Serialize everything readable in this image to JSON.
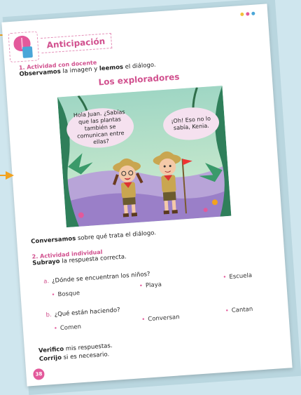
{
  "section": {
    "title": "Anticipación"
  },
  "activity1": {
    "label": "1. Actividad con docente",
    "instruction_b1": "Observamos",
    "instruction_t1": " la imagen y ",
    "instruction_b2": "leemos",
    "instruction_t2": " el diálogo."
  },
  "story": {
    "title": "Los exploradores",
    "bubble_left": "Hola Juan. ¿Sabías que las plantas también se comunican entre ellas?",
    "bubble_right": "¡Oh! Eso no lo sabía, Kenia."
  },
  "discussion": {
    "bold": "Conversamos",
    "text": " sobre qué trata el diálogo."
  },
  "activity2": {
    "label": "2. Actividad individual",
    "instruction_b": "Subrayo",
    "instruction_t": " la respuesta correcta.",
    "questions": [
      {
        "letter": "a.",
        "text": "¿Dónde se encuentran los niños?",
        "options": [
          "Bosque",
          "Playa",
          "Escuela"
        ]
      },
      {
        "letter": "b.",
        "text": "¿Qué están haciendo?",
        "options": [
          "Comen",
          "Conversan",
          "Cantan"
        ]
      }
    ]
  },
  "footer": {
    "line1_b": "Verifico",
    "line1_t": " mis respuestas.",
    "line2_b": "Corrijo",
    "line2_t": " si es necesario."
  },
  "page_number": "38",
  "colors": {
    "accent_pink": "#d1508e",
    "pointer_orange": "#f2a21e",
    "dots": [
      "#f2c13a",
      "#e3599b",
      "#4aa6d8"
    ]
  }
}
